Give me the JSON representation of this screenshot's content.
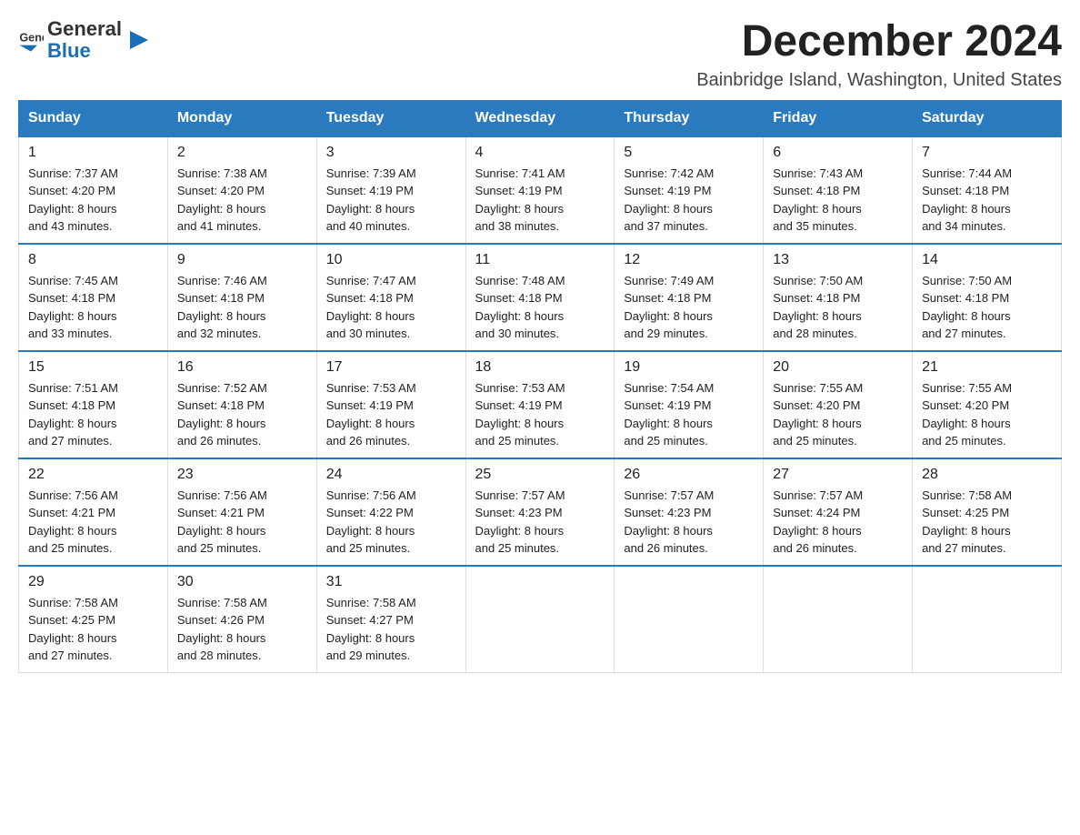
{
  "logo": {
    "text_general": "General",
    "text_blue": "Blue"
  },
  "header": {
    "month_year": "December 2024",
    "location": "Bainbridge Island, Washington, United States"
  },
  "weekdays": [
    "Sunday",
    "Monday",
    "Tuesday",
    "Wednesday",
    "Thursday",
    "Friday",
    "Saturday"
  ],
  "weeks": [
    [
      {
        "day": "1",
        "sunrise": "7:37 AM",
        "sunset": "4:20 PM",
        "daylight": "8 hours and 43 minutes."
      },
      {
        "day": "2",
        "sunrise": "7:38 AM",
        "sunset": "4:20 PM",
        "daylight": "8 hours and 41 minutes."
      },
      {
        "day": "3",
        "sunrise": "7:39 AM",
        "sunset": "4:19 PM",
        "daylight": "8 hours and 40 minutes."
      },
      {
        "day": "4",
        "sunrise": "7:41 AM",
        "sunset": "4:19 PM",
        "daylight": "8 hours and 38 minutes."
      },
      {
        "day": "5",
        "sunrise": "7:42 AM",
        "sunset": "4:19 PM",
        "daylight": "8 hours and 37 minutes."
      },
      {
        "day": "6",
        "sunrise": "7:43 AM",
        "sunset": "4:18 PM",
        "daylight": "8 hours and 35 minutes."
      },
      {
        "day": "7",
        "sunrise": "7:44 AM",
        "sunset": "4:18 PM",
        "daylight": "8 hours and 34 minutes."
      }
    ],
    [
      {
        "day": "8",
        "sunrise": "7:45 AM",
        "sunset": "4:18 PM",
        "daylight": "8 hours and 33 minutes."
      },
      {
        "day": "9",
        "sunrise": "7:46 AM",
        "sunset": "4:18 PM",
        "daylight": "8 hours and 32 minutes."
      },
      {
        "day": "10",
        "sunrise": "7:47 AM",
        "sunset": "4:18 PM",
        "daylight": "8 hours and 30 minutes."
      },
      {
        "day": "11",
        "sunrise": "7:48 AM",
        "sunset": "4:18 PM",
        "daylight": "8 hours and 30 minutes."
      },
      {
        "day": "12",
        "sunrise": "7:49 AM",
        "sunset": "4:18 PM",
        "daylight": "8 hours and 29 minutes."
      },
      {
        "day": "13",
        "sunrise": "7:50 AM",
        "sunset": "4:18 PM",
        "daylight": "8 hours and 28 minutes."
      },
      {
        "day": "14",
        "sunrise": "7:50 AM",
        "sunset": "4:18 PM",
        "daylight": "8 hours and 27 minutes."
      }
    ],
    [
      {
        "day": "15",
        "sunrise": "7:51 AM",
        "sunset": "4:18 PM",
        "daylight": "8 hours and 27 minutes."
      },
      {
        "day": "16",
        "sunrise": "7:52 AM",
        "sunset": "4:18 PM",
        "daylight": "8 hours and 26 minutes."
      },
      {
        "day": "17",
        "sunrise": "7:53 AM",
        "sunset": "4:19 PM",
        "daylight": "8 hours and 26 minutes."
      },
      {
        "day": "18",
        "sunrise": "7:53 AM",
        "sunset": "4:19 PM",
        "daylight": "8 hours and 25 minutes."
      },
      {
        "day": "19",
        "sunrise": "7:54 AM",
        "sunset": "4:19 PM",
        "daylight": "8 hours and 25 minutes."
      },
      {
        "day": "20",
        "sunrise": "7:55 AM",
        "sunset": "4:20 PM",
        "daylight": "8 hours and 25 minutes."
      },
      {
        "day": "21",
        "sunrise": "7:55 AM",
        "sunset": "4:20 PM",
        "daylight": "8 hours and 25 minutes."
      }
    ],
    [
      {
        "day": "22",
        "sunrise": "7:56 AM",
        "sunset": "4:21 PM",
        "daylight": "8 hours and 25 minutes."
      },
      {
        "day": "23",
        "sunrise": "7:56 AM",
        "sunset": "4:21 PM",
        "daylight": "8 hours and 25 minutes."
      },
      {
        "day": "24",
        "sunrise": "7:56 AM",
        "sunset": "4:22 PM",
        "daylight": "8 hours and 25 minutes."
      },
      {
        "day": "25",
        "sunrise": "7:57 AM",
        "sunset": "4:23 PM",
        "daylight": "8 hours and 25 minutes."
      },
      {
        "day": "26",
        "sunrise": "7:57 AM",
        "sunset": "4:23 PM",
        "daylight": "8 hours and 26 minutes."
      },
      {
        "day": "27",
        "sunrise": "7:57 AM",
        "sunset": "4:24 PM",
        "daylight": "8 hours and 26 minutes."
      },
      {
        "day": "28",
        "sunrise": "7:58 AM",
        "sunset": "4:25 PM",
        "daylight": "8 hours and 27 minutes."
      }
    ],
    [
      {
        "day": "29",
        "sunrise": "7:58 AM",
        "sunset": "4:25 PM",
        "daylight": "8 hours and 27 minutes."
      },
      {
        "day": "30",
        "sunrise": "7:58 AM",
        "sunset": "4:26 PM",
        "daylight": "8 hours and 28 minutes."
      },
      {
        "day": "31",
        "sunrise": "7:58 AM",
        "sunset": "4:27 PM",
        "daylight": "8 hours and 29 minutes."
      },
      null,
      null,
      null,
      null
    ]
  ],
  "labels": {
    "sunrise": "Sunrise: ",
    "sunset": "Sunset: ",
    "daylight": "Daylight: "
  }
}
